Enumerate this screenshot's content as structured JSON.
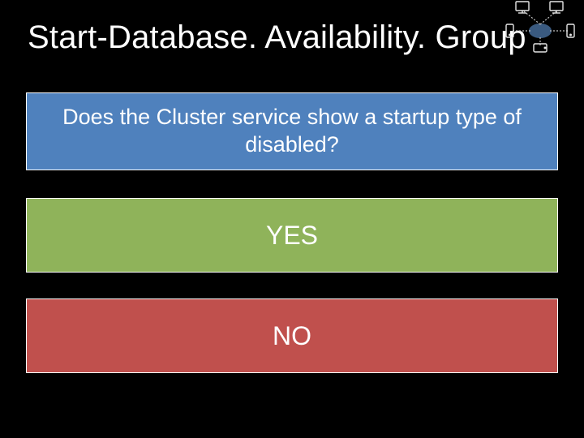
{
  "title": "Start-Database. Availability. Group",
  "question": "Does the Cluster service show a startup type of disabled?",
  "answers": {
    "yes": "YES",
    "no": "NO"
  },
  "colors": {
    "bg": "#000000",
    "question": "#4f81bd",
    "yes": "#8fb35a",
    "no": "#c0504d",
    "text": "#ffffff"
  }
}
